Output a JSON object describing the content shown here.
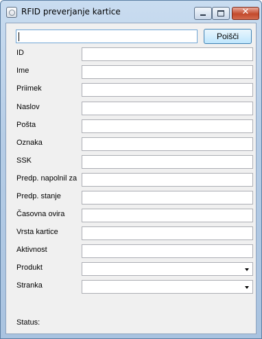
{
  "window": {
    "title": "RFID preverjanje kartice",
    "close_glyph": "✕"
  },
  "search": {
    "value": "",
    "button_label": "Poišči"
  },
  "fields": [
    {
      "label": "ID",
      "value": ""
    },
    {
      "label": "Ime",
      "value": ""
    },
    {
      "label": "Priimek",
      "value": ""
    },
    {
      "label": "Naslov",
      "value": ""
    },
    {
      "label": "Pošta",
      "value": ""
    },
    {
      "label": "Oznaka",
      "value": ""
    },
    {
      "label": "SSK",
      "value": ""
    },
    {
      "label": "Predp. napolnil za",
      "value": ""
    },
    {
      "label": "Predp. stanje",
      "value": ""
    },
    {
      "label": "Časovna ovira",
      "value": ""
    },
    {
      "label": "Vrsta kartice",
      "value": ""
    },
    {
      "label": "Aktivnost",
      "value": ""
    }
  ],
  "dropdowns": [
    {
      "label": "Produkt",
      "value": ""
    },
    {
      "label": "Stranka",
      "value": ""
    }
  ],
  "status": {
    "label": "Status:",
    "value": ""
  }
}
